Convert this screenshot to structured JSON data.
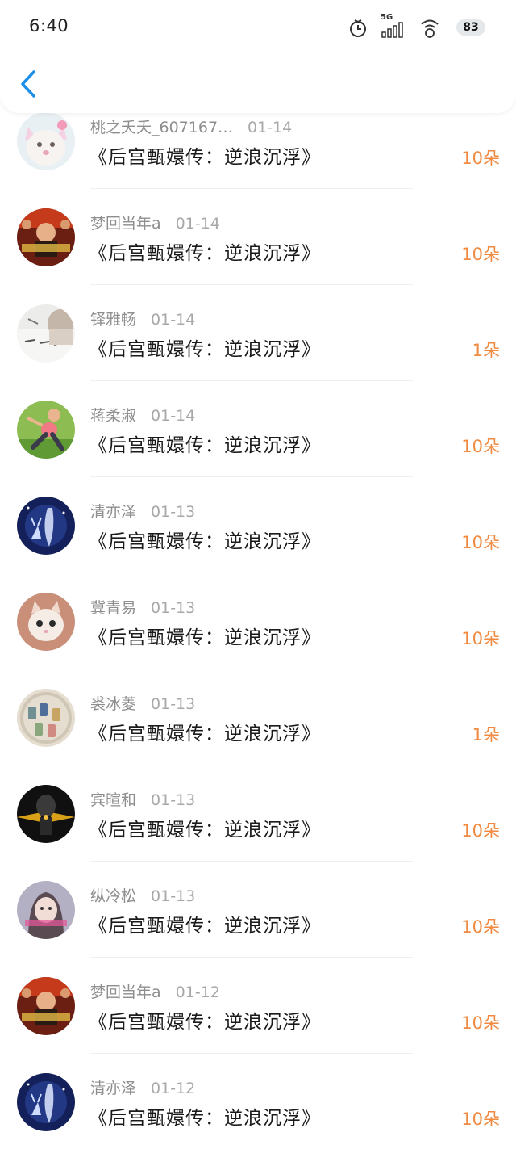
{
  "status_bar": {
    "time": "6:40",
    "network": "5G",
    "battery": "83",
    "icons": [
      "alarm-icon",
      "signal-icon",
      "wifi-icon",
      "battery-icon"
    ]
  },
  "nav": {
    "back_icon": "chevron-left-icon",
    "accent_color": "#1e8fe8"
  },
  "colors": {
    "amount": "#f08a40",
    "name": "#8e8e8e",
    "title": "#1a1a1a"
  },
  "items": [
    {
      "name": "桃之夭夭_607167…",
      "date": "01-14",
      "title": "《后宫甄嬛传：逆浪沉浮》",
      "amount": "10朵",
      "avatar": "avatar-cat-icon"
    },
    {
      "name": "梦回当年a",
      "date": "01-14",
      "title": "《后宫甄嬛传：逆浪沉浮》",
      "amount": "10朵",
      "avatar": "avatar-poster-icon"
    },
    {
      "name": "铎雅畅",
      "date": "01-14",
      "title": "《后宫甄嬛传：逆浪沉浮》",
      "amount": "1朵",
      "avatar": "avatar-calligraphy-icon"
    },
    {
      "name": "蒋柔淑",
      "date": "01-14",
      "title": "《后宫甄嬛传：逆浪沉浮》",
      "amount": "10朵",
      "avatar": "avatar-yoga-icon"
    },
    {
      "name": "清亦泽",
      "date": "01-13",
      "title": "《后宫甄嬛传：逆浪沉浮》",
      "amount": "10朵",
      "avatar": "avatar-deer-icon"
    },
    {
      "name": "冀青易",
      "date": "01-13",
      "title": "《后宫甄嬛传：逆浪沉浮》",
      "amount": "10朵",
      "avatar": "avatar-kitten-icon"
    },
    {
      "name": "裘冰菱",
      "date": "01-13",
      "title": "《后宫甄嬛传：逆浪沉浮》",
      "amount": "1朵",
      "avatar": "avatar-spools-icon"
    },
    {
      "name": "宾暄和",
      "date": "01-13",
      "title": "《后宫甄嬛传：逆浪沉浮》",
      "amount": "10朵",
      "avatar": "avatar-dark-icon"
    },
    {
      "name": "纵冷松",
      "date": "01-13",
      "title": "《后宫甄嬛传：逆浪沉浮》",
      "amount": "10朵",
      "avatar": "avatar-girl-icon"
    },
    {
      "name": "梦回当年a",
      "date": "01-12",
      "title": "《后宫甄嬛传：逆浪沉浮》",
      "amount": "10朵",
      "avatar": "avatar-poster-icon"
    },
    {
      "name": "清亦泽",
      "date": "01-12",
      "title": "《后宫甄嬛传：逆浪沉浮》",
      "amount": "10朵",
      "avatar": "avatar-deer-icon"
    }
  ]
}
